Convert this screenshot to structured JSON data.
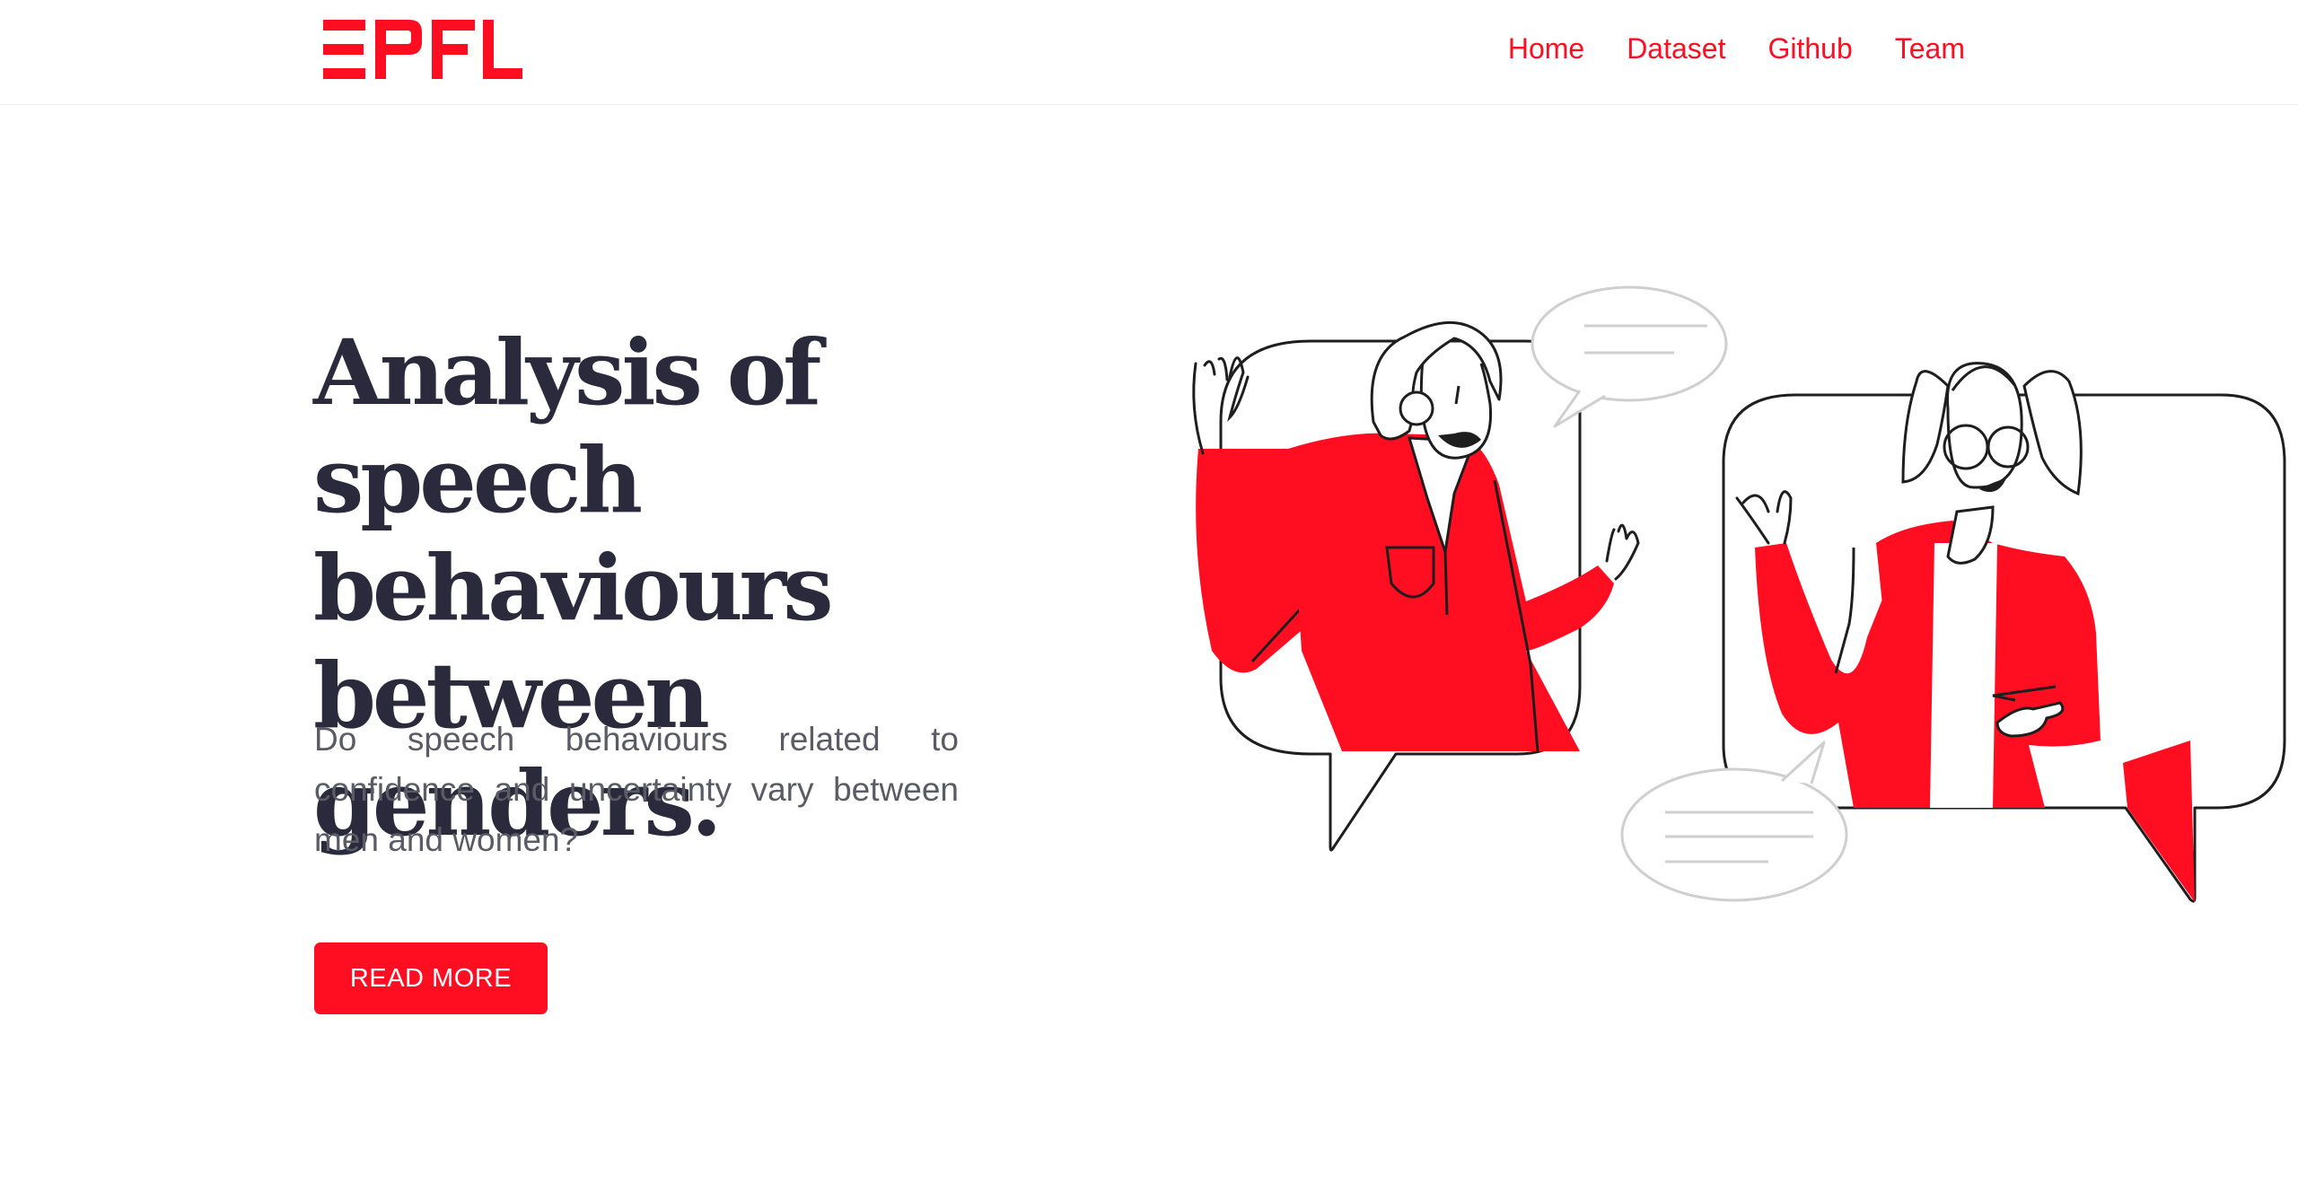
{
  "header": {
    "logo_text": "EPFL",
    "nav": {
      "home": "Home",
      "dataset": "Dataset",
      "github": "Github",
      "team": "Team"
    }
  },
  "hero": {
    "title": "Analysis of speech behaviours between genders.",
    "description": "Do speech behaviours related to confidence and uncertainty vary between men and women?",
    "cta_label": "READ MORE"
  },
  "colors": {
    "brand_red": "#ff0d21",
    "title_dark": "#2b2a3d",
    "body_gray": "#5b5b66"
  }
}
